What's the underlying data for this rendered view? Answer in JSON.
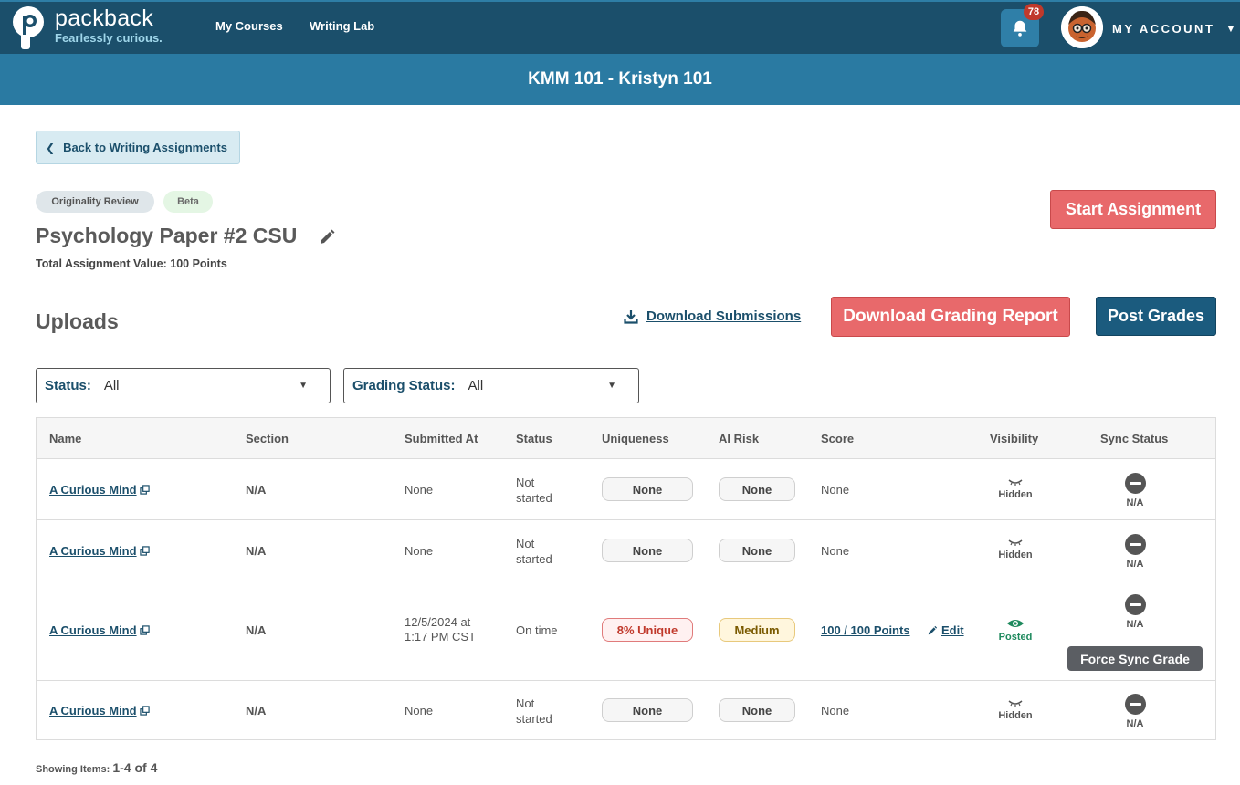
{
  "brand": {
    "name": "packback",
    "tagline": "Fearlessly curious."
  },
  "nav": {
    "my_courses": "My Courses",
    "writing_lab": "Writing Lab",
    "notifications_count": "78",
    "account_label": "MY ACCOUNT",
    "account_caret": "▼"
  },
  "course": {
    "title": "KMM 101 - Kristyn 101"
  },
  "back_label": "Back to Writing Assignments",
  "tags": {
    "originality": "Originality Review",
    "beta": "Beta"
  },
  "assignment": {
    "title": "Psychology Paper #2 CSU",
    "total_value": "Total Assignment Value: 100 Points",
    "start_label": "Start Assignment"
  },
  "uploads": {
    "title": "Uploads",
    "download_submissions": "Download Submissions",
    "download_report": "Download Grading Report",
    "post_grades": "Post Grades"
  },
  "filters": {
    "status_label": "Status:",
    "status_value": "All",
    "grading_label": "Grading Status:",
    "grading_value": "All"
  },
  "table": {
    "headers": {
      "name": "Name",
      "section": "Section",
      "submitted": "Submitted At",
      "status": "Status",
      "uniqueness": "Uniqueness",
      "ai_risk": "AI Risk",
      "score": "Score",
      "visibility": "Visibility",
      "sync": "Sync Status"
    },
    "rows": [
      {
        "name": "A Curious Mind",
        "section": "N/A",
        "submitted_1": "None",
        "submitted_2": "",
        "status_1": "Not",
        "status_2": "started",
        "uniqueness": "None",
        "ai_risk": "None",
        "score": "None",
        "visibility": "Hidden",
        "sync": "N/A"
      },
      {
        "name": "A Curious Mind",
        "section": "N/A",
        "submitted_1": "None",
        "submitted_2": "",
        "status_1": "Not",
        "status_2": "started",
        "uniqueness": "None",
        "ai_risk": "None",
        "score": "None",
        "visibility": "Hidden",
        "sync": "N/A"
      },
      {
        "name": "A Curious Mind",
        "section": "N/A",
        "submitted_1": "12/5/2024 at",
        "submitted_2": "1:17 PM CST",
        "status_1": "On time",
        "status_2": "",
        "uniqueness": "8% Unique",
        "ai_risk": "Medium",
        "score": "100 / 100 Points",
        "edit": "Edit",
        "visibility": "Posted",
        "sync": "N/A",
        "tooltip": "Force Sync Grade"
      },
      {
        "name": "A Curious Mind",
        "section": "N/A",
        "submitted_1": "None",
        "submitted_2": "",
        "status_1": "Not",
        "status_2": "started",
        "uniqueness": "None",
        "ai_risk": "None",
        "score": "None",
        "visibility": "Hidden",
        "sync": "N/A"
      }
    ]
  },
  "footer": {
    "showing_label": "Showing Items:",
    "showing_count": "1-4 of 4"
  },
  "colors": {
    "nav_bg": "#1b4f6b",
    "course_bar": "#2a7aa2",
    "accent_red": "#e8696b",
    "primary_blue": "#1b5b7e",
    "posted_green": "#1f8a5e"
  }
}
